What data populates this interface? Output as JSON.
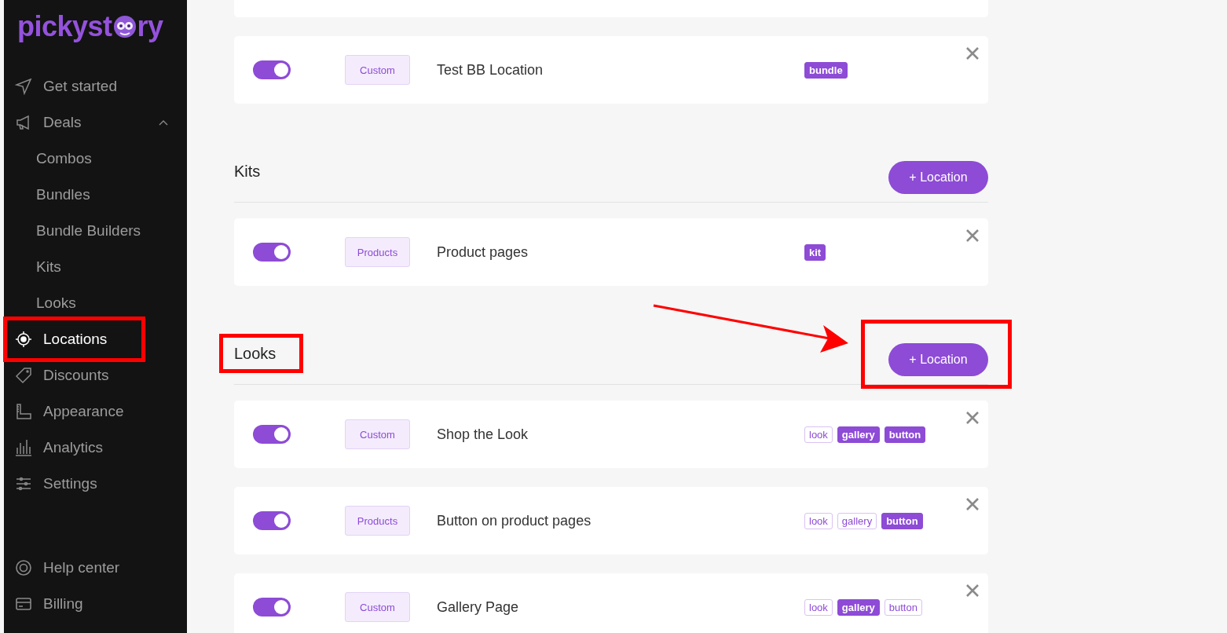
{
  "logo": {
    "text_start": "pickyst",
    "text_end": "ry"
  },
  "nav": [
    {
      "label": "Get started",
      "kind": "main",
      "selected": false,
      "highlighted": false
    },
    {
      "label": "Deals",
      "kind": "main",
      "selected": false,
      "expanded": true,
      "highlighted": false
    },
    {
      "label": "Combos",
      "kind": "sub",
      "selected": false,
      "highlighted": false
    },
    {
      "label": "Bundles",
      "kind": "sub",
      "selected": false,
      "highlighted": false
    },
    {
      "label": "Bundle Builders",
      "kind": "sub",
      "selected": false,
      "highlighted": false
    },
    {
      "label": "Kits",
      "kind": "sub",
      "selected": false,
      "highlighted": false
    },
    {
      "label": "Looks",
      "kind": "sub",
      "selected": false,
      "highlighted": false
    },
    {
      "label": "Locations",
      "kind": "main",
      "selected": true,
      "highlighted": true
    },
    {
      "label": "Discounts",
      "kind": "main",
      "selected": false,
      "highlighted": false
    },
    {
      "label": "Appearance",
      "kind": "main",
      "selected": false,
      "highlighted": false
    },
    {
      "label": "Analytics",
      "kind": "main",
      "selected": false,
      "highlighted": false
    },
    {
      "label": "Settings",
      "kind": "main",
      "selected": false,
      "highlighted": false
    }
  ],
  "nav_bottom": [
    {
      "label": "Help center"
    },
    {
      "label": "Billing"
    }
  ],
  "top_cards": [
    {
      "on": true,
      "type": "Custom",
      "name": "Test BB Location",
      "tags": [
        {
          "label": "bundle",
          "filled": true
        }
      ]
    }
  ],
  "sections": [
    {
      "title": "Kits",
      "highlighted": false,
      "add_button": {
        "label": "+ Location",
        "highlighted": false
      },
      "cards": [
        {
          "on": true,
          "type": "Products",
          "name": "Product pages",
          "tags": [
            {
              "label": "kit",
              "filled": true
            }
          ]
        }
      ]
    },
    {
      "title": "Looks",
      "highlighted": true,
      "add_button": {
        "label": "+ Location",
        "highlighted": true
      },
      "cards": [
        {
          "on": true,
          "type": "Custom",
          "name": "Shop the Look",
          "tags": [
            {
              "label": "look",
              "filled": false
            },
            {
              "label": "gallery",
              "filled": true
            },
            {
              "label": "button",
              "filled": true
            }
          ]
        },
        {
          "on": true,
          "type": "Products",
          "name": "Button on product pages",
          "tags": [
            {
              "label": "look",
              "filled": false
            },
            {
              "label": "gallery",
              "filled": false
            },
            {
              "label": "button",
              "filled": true
            }
          ]
        },
        {
          "on": true,
          "type": "Custom",
          "name": "Gallery Page",
          "tags": [
            {
              "label": "look",
              "filled": false
            },
            {
              "label": "gallery",
              "filled": true
            },
            {
              "label": "button",
              "filled": false
            }
          ]
        }
      ]
    }
  ]
}
